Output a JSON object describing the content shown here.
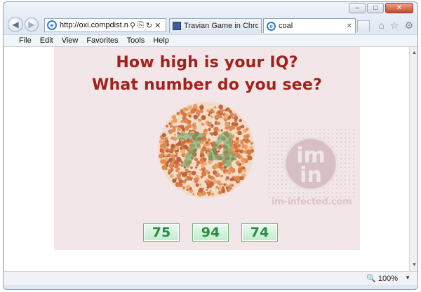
{
  "browser": {
    "address": "http://oxi.compdist.ne",
    "tabs": [
      {
        "label": "Travian Game in Chrome - ..."
      },
      {
        "label": "coal"
      }
    ],
    "menu": [
      "File",
      "Edit",
      "View",
      "Favorites",
      "Tools",
      "Help"
    ],
    "zoom": "100%",
    "caption_buttons": {
      "minimize": "‒",
      "maximize": "□",
      "close": "✕"
    },
    "icons": {
      "back": "◀",
      "forward": "▶",
      "search": "⚲",
      "compat": "⎘",
      "refresh": "↻",
      "stop": "✕",
      "tab_close": "✕",
      "home": "⌂",
      "favorites": "☆",
      "settings": "⚙",
      "zoom": "🔍",
      "zoom_arrow": "▼",
      "scroll_up": "▲",
      "scroll_down": "▼",
      "ie_logo": "e"
    }
  },
  "page": {
    "headline_1": "How high is your IQ?",
    "headline_2": "What number do you see?",
    "answers": [
      "75",
      "94",
      "74"
    ],
    "plate_number": "74",
    "watermark_logo_top": "im",
    "watermark_logo_bottom": "in",
    "watermark_text": "im-infected.com",
    "colors": {
      "headline": "#a3201c",
      "answer_text": "#2f8a45",
      "banner_bg": "#f3e6e8"
    }
  }
}
